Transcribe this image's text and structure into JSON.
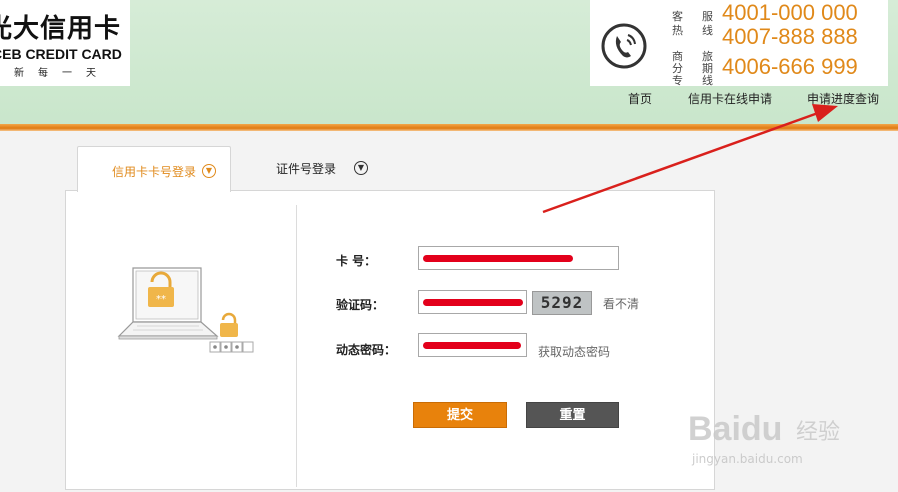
{
  "header": {
    "logo_cn": "光大信用卡",
    "logo_en": "CEB CREDIT CARD",
    "logo_slogan": "新每一天",
    "hotlines": [
      {
        "label_a": "客",
        "label_b": "服",
        "label_c": "热",
        "label_d": "线",
        "number": "4001-000 000"
      },
      {
        "number": "4007-888 888"
      },
      {
        "label_a": "商",
        "label_b": "旅",
        "label_c": "分",
        "label_d": "期",
        "label_e": "专",
        "label_f": "线",
        "number": "4006-666 999"
      }
    ]
  },
  "nav": {
    "home": "首页",
    "apply_online": "信用卡在线申请",
    "progress_query": "申请进度查询"
  },
  "tabs": {
    "card_login": "信用卡卡号登录",
    "id_login": "证件号登录"
  },
  "form": {
    "card_label": "卡 号：",
    "captcha_label": "验证码：",
    "captcha_value": "5292",
    "captcha_refresh": "看不清",
    "dynamic_label": "动态密码：",
    "get_dynamic": "获取动态密码",
    "submit": "提交",
    "reset": "重置"
  },
  "watermark": {
    "main": "Baidu",
    "cn": "经验",
    "url": "jingyan.baidu.com"
  },
  "colors": {
    "accent_orange": "#e8820c",
    "header_green": "#c9e6cb",
    "redaction_red": "#e3001b",
    "arrow_red": "#d9201c"
  }
}
